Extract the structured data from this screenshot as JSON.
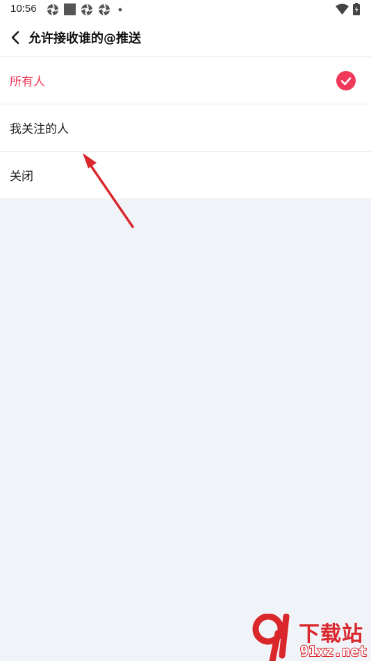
{
  "status_bar": {
    "time": "10:56",
    "icons": [
      "aperture-icon",
      "square-icon",
      "aperture-icon",
      "aperture-icon",
      "dot-icon",
      "wifi-icon",
      "battery-icon"
    ]
  },
  "header": {
    "title": "允许接收谁的@推送",
    "back_icon": "chevron-left-icon"
  },
  "options": [
    {
      "label": "所有人",
      "selected": true
    },
    {
      "label": "我关注的人",
      "selected": false
    },
    {
      "label": "关闭",
      "selected": false
    }
  ],
  "watermark": {
    "title": "下载站",
    "domain": "91xz.net"
  },
  "colors": {
    "accent": "#f0395a",
    "page_background": "#f0f3f7",
    "annotation_arrow": "#d9272c",
    "watermark": "#d9272c"
  }
}
